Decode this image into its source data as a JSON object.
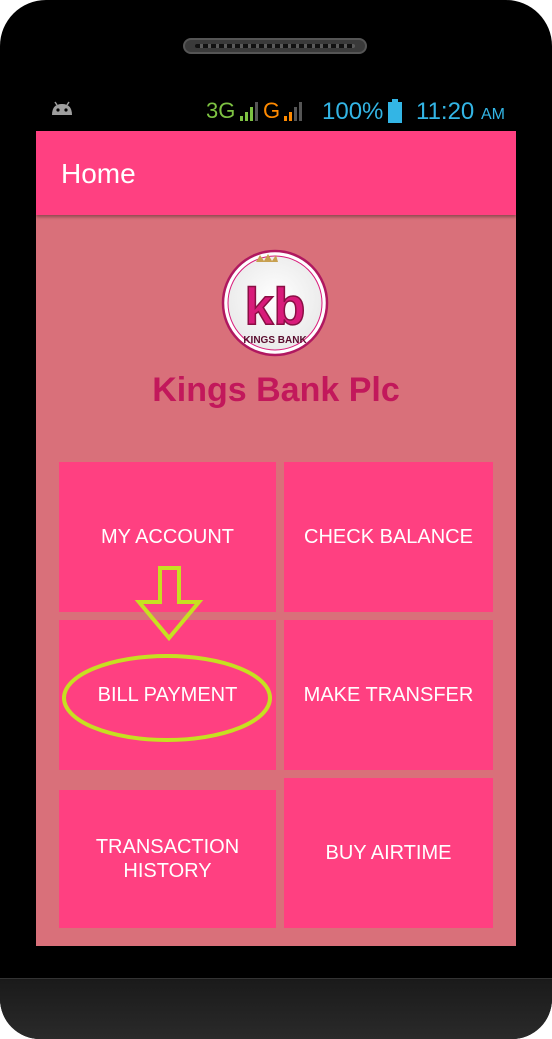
{
  "status_bar": {
    "network_3g": "3G",
    "network_g": "G",
    "battery": "100%",
    "time": "11:20",
    "ampm": "AM",
    "colors": {
      "status_text": "#33b5e5",
      "net_3g": "#7dc242",
      "net_g": "#ff8a00"
    }
  },
  "app_bar": {
    "title": "Home",
    "color": "#ff4081"
  },
  "logo": {
    "letters": "kb",
    "caption": "KINGS BANK"
  },
  "bank_name": "Kings Bank Plc",
  "menu": {
    "my_account": "MY ACCOUNT",
    "check_balance": "CHECK BALANCE",
    "bill_payment": "BILL PAYMENT",
    "make_transfer": "MAKE TRANSFER",
    "transaction_history": "TRANSACTION HISTORY",
    "buy_airtime": "BUY AIRTIME"
  },
  "colors": {
    "background": "#d9707a",
    "tile": "#ff4081",
    "bank_name": "#c2185b",
    "highlight": "#c6e021"
  }
}
